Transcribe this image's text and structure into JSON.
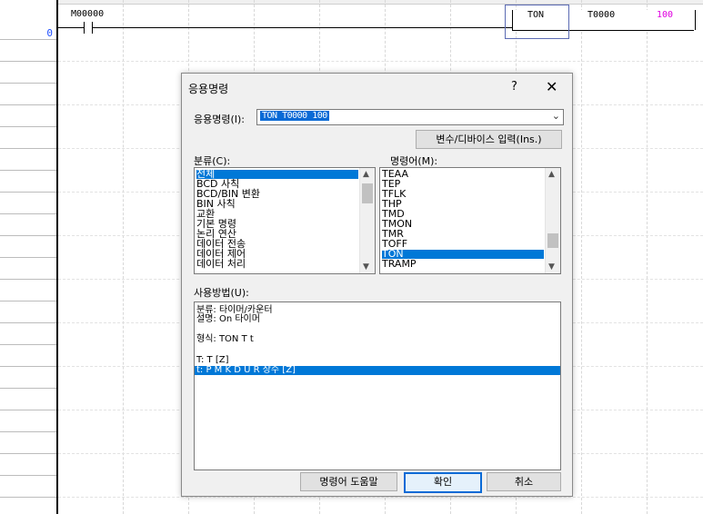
{
  "ladder": {
    "row_number": "0",
    "contact_label": "M00000",
    "instruction": {
      "name": "TON",
      "operand": "T0000",
      "value": "100"
    }
  },
  "dialog": {
    "title": "응용명령",
    "help_label": "?",
    "close_label": "✕",
    "app_cmd_label": "응용명령(I):",
    "app_cmd_value": "TON T0000 100",
    "combo_arrow": "⌄",
    "var_device_button": "변수/디바이스 입력(Ins.)",
    "category_label": "분류(C):",
    "command_label": "명령어(M):",
    "categories": [
      "전체",
      "BCD 사칙",
      "BCD/BIN 변환",
      "BIN 사칙",
      "교환",
      "기본 명령",
      "논리 연산",
      "데이터 전송",
      "데이터 제어",
      "데이터 처리"
    ],
    "commands": [
      "TEAA",
      "TEP",
      "TFLK",
      "THP",
      "TMD",
      "TMON",
      "TMR",
      "TOFF",
      "TON",
      "TRAMP"
    ],
    "usage_label": "사용방법(U):",
    "usage_lines": [
      "분류: 타이머/카운터",
      "설명: On 타이머",
      "형식: TON T t",
      "T:  T [Z]",
      "t:  P M K D U R 상수 [Z]"
    ],
    "help_button": "명령어 도움말",
    "ok_button": "확인",
    "cancel_button": "취소"
  },
  "colors": {
    "selection": "#0078d7",
    "row_number": "#1f4fff",
    "value_magenta": "#e000e0",
    "instr_highlight": "#5b6bb3"
  },
  "icons": {
    "scroll_up": "chevron-up-icon",
    "scroll_down": "chevron-down-icon",
    "close": "close-icon",
    "help": "help-icon",
    "combo": "chevron-down-icon"
  }
}
